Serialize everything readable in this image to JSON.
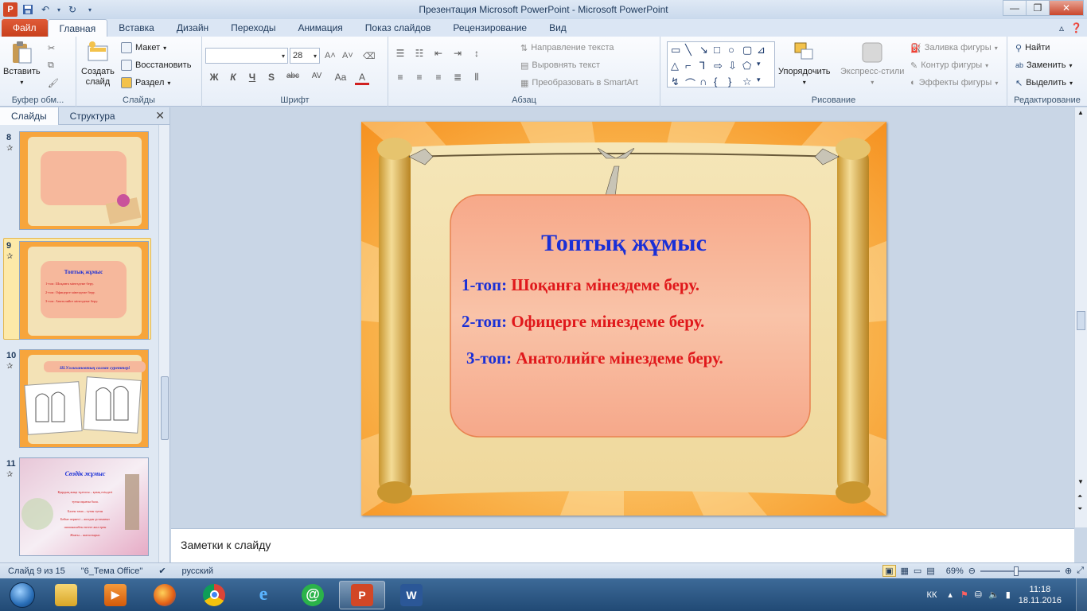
{
  "window": {
    "title": "Презентация Microsoft PowerPoint  -  Microsoft PowerPoint"
  },
  "tabs": {
    "file": "Файл",
    "items": [
      "Главная",
      "Вставка",
      "Дизайн",
      "Переходы",
      "Анимация",
      "Показ слайдов",
      "Рецензирование",
      "Вид"
    ]
  },
  "ribbon": {
    "clipboard": {
      "paste": "Вставить",
      "label": "Буфер обм..."
    },
    "slides": {
      "create_line1": "Создать",
      "create_line2": "слайд",
      "layout": "Макет",
      "reset": "Восстановить",
      "section": "Раздел",
      "label": "Слайды"
    },
    "font": {
      "size": "28",
      "label": "Шрифт",
      "bold": "Ж",
      "italic": "К",
      "underline": "Ч",
      "shadow": "S",
      "strike": "abc",
      "spacing": "AV",
      "case": "Aa",
      "color": "A"
    },
    "paragraph": {
      "text_direction": "Направление текста",
      "align_text": "Выровнять текст",
      "smartart": "Преобразовать в SmartArt",
      "label": "Абзац"
    },
    "drawing": {
      "arrange": "Упорядочить",
      "quick_styles": "Экспресс-стили",
      "fill": "Заливка фигуры",
      "outline": "Контур фигуры",
      "effects": "Эффекты фигуры",
      "label": "Рисование"
    },
    "editing": {
      "find": "Найти",
      "replace": "Заменить",
      "select": "Выделить",
      "label": "Редактирование"
    }
  },
  "left_panel": {
    "tab_slides": "Слайды",
    "tab_outline": "Структура",
    "slides": [
      {
        "num": "8"
      },
      {
        "num": "9",
        "title": "Топтық жұмыс",
        "lines": [
          "1-топ: Шоқанға мінездеме беру.",
          "2-топ: Офицерге мінездеме беру.",
          "3-топ: Анатолийге мінездеме беру."
        ]
      },
      {
        "num": "10",
        "title": "Ш.Уәлихановтың салған суреттері"
      },
      {
        "num": "11",
        "title": "Сөздік жұмыс",
        "lines": [
          "Қырдың жаңа тұлғасы – қазақ еліндегі",
          "туған оқыған бала.",
          "Бәлен тама – туған туған",
          "Бейне пернесі – жолдан ұстамағыт",
          "шапоналабек ептеге жол ерен",
          "Жазғы – шатастырыс"
        ]
      }
    ]
  },
  "slide": {
    "title": "Топтық жұмыс",
    "items": [
      {
        "prefix": "1-топ: ",
        "text": "Шоқанға    мінездеме беру."
      },
      {
        "prefix": "2-топ: ",
        "text": "Офицерге мінездеме беру."
      },
      {
        "prefix": "3-топ: ",
        "text": "Анатолийге мінездеме беру."
      }
    ],
    "colors": {
      "title": "#1a2fd6",
      "prefix": "#1a2fd6",
      "text": "#e0181b",
      "panel": "#f6b89c",
      "frame": "#f59a1e"
    }
  },
  "notes": {
    "placeholder": "Заметки к слайду"
  },
  "status": {
    "slide_info": "Слайд 9 из 15",
    "theme": "\"6_Тема Office\"",
    "language": "русский",
    "zoom": "69%"
  },
  "taskbar": {
    "lang": "КК",
    "time": "11:18",
    "date": "18.11.2016"
  }
}
